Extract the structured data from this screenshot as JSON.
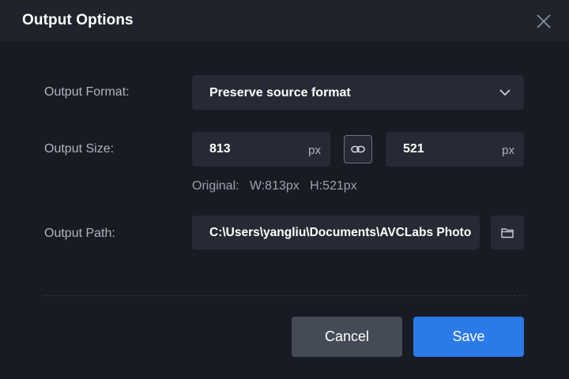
{
  "dialog": {
    "title": "Output Options",
    "close_icon": "close-icon"
  },
  "format": {
    "label": "Output Format:",
    "value": "Preserve source format",
    "icon": "chevron-down-icon"
  },
  "size": {
    "label": "Output Size:",
    "width": "813",
    "height": "521",
    "unit": "px",
    "link_icon": "link-icon",
    "original": "Original:   W:813px   H:521px"
  },
  "path": {
    "label": "Output Path:",
    "value": "C:\\Users\\yangliu\\Documents\\AVCLabs Photo",
    "folder_icon": "folder-icon"
  },
  "buttons": {
    "cancel": "Cancel",
    "save": "Save"
  },
  "colors": {
    "accent": "#2a7ae8",
    "background": "#181b23",
    "field": "#262a34"
  }
}
